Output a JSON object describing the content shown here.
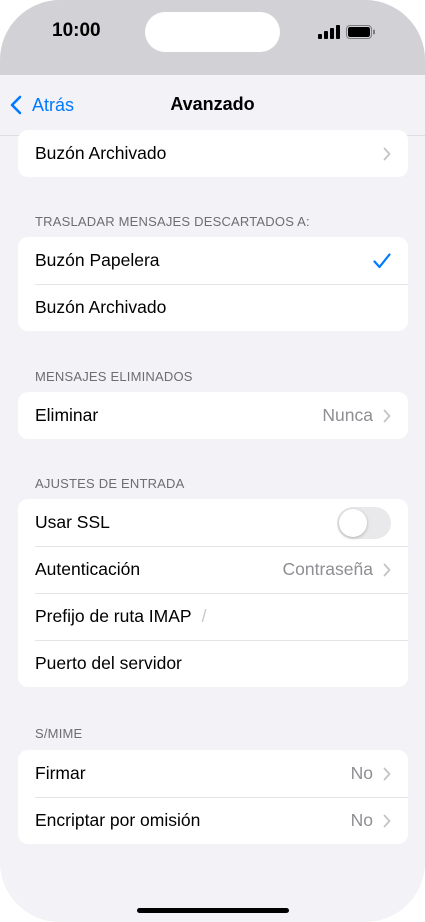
{
  "status_bar": {
    "time": "10:00"
  },
  "nav": {
    "back_label": "Atrás",
    "title": "Avanzado"
  },
  "top_group": {
    "archived_label": "Buzón Archivado"
  },
  "move_discarded": {
    "header": "TRASLADAR MENSAJES DESCARTADOS A:",
    "items": [
      {
        "label": "Buzón Papelera",
        "selected": true
      },
      {
        "label": "Buzón Archivado",
        "selected": false
      }
    ]
  },
  "deleted_messages": {
    "header": "MENSAJES ELIMINADOS",
    "delete_label": "Eliminar",
    "delete_value": "Nunca"
  },
  "incoming": {
    "header": "AJUSTES DE ENTRADA",
    "ssl_label": "Usar SSL",
    "ssl_on": false,
    "auth_label": "Autenticación",
    "auth_value": "Contraseña",
    "imap_prefix_label": "Prefijo de ruta IMAP",
    "imap_prefix_value": "/",
    "port_label": "Puerto del servidor"
  },
  "smime": {
    "header": "S/MIME",
    "sign_label": "Firmar",
    "sign_value": "No",
    "encrypt_label": "Encriptar por omisión",
    "encrypt_value": "No"
  },
  "colors": {
    "accent": "#007aff",
    "secondary_text": "#8e8e93",
    "background": "#f2f2f7"
  }
}
